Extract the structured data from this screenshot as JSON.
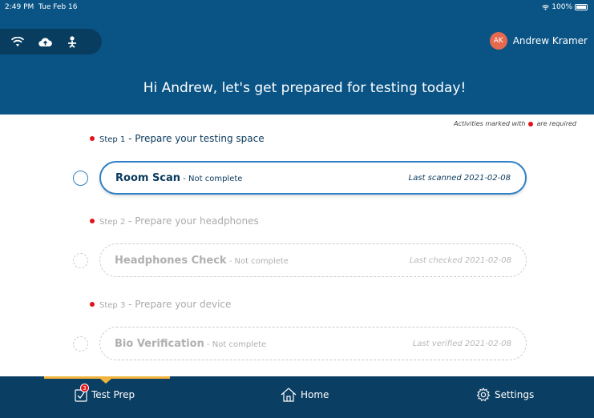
{
  "status_bar": {
    "time": "2:49 PM",
    "date": "Tue Feb 16",
    "battery": "100%"
  },
  "header": {
    "connection_icons": [
      "wifi-icon",
      "cloud-upload-icon",
      "person-icon"
    ],
    "user_initials": "AK",
    "user_name": "Andrew Kramer",
    "greeting": "Hi Andrew, let's get prepared for testing today!"
  },
  "required_note": {
    "prefix": "Activities marked with",
    "suffix": "are required"
  },
  "steps": [
    {
      "step": "Step 1",
      "label": " - Prepare your testing space",
      "card_title": "Room Scan",
      "card_status": " - Not complete",
      "card_date": "Last scanned 2021-02-08",
      "active": true
    },
    {
      "step": "Step 2",
      "label": " - Prepare your headphones",
      "card_title": "Headphones Check",
      "card_status": " - Not complete",
      "card_date": "Last checked 2021-02-08",
      "active": false
    },
    {
      "step": "Step 3",
      "label": " - Prepare your device",
      "card_title": "Bio Verification",
      "card_status": " - Not complete",
      "card_date": "Last verified 2021-02-08",
      "active": false
    }
  ],
  "tabbar": {
    "tabs": [
      {
        "label": "Test Prep",
        "icon": "checklist-icon",
        "badge": "3",
        "active": true
      },
      {
        "label": "Home",
        "icon": "home-icon"
      },
      {
        "label": "Settings",
        "icon": "gear-icon"
      }
    ]
  },
  "colors": {
    "header_bg": "#0a5485",
    "tabbar_bg": "#0a3e62",
    "accent": "#2f80c4",
    "required_dot": "#e3131b",
    "tab_indicator": "#f0b43c",
    "avatar": "#e4694f"
  }
}
